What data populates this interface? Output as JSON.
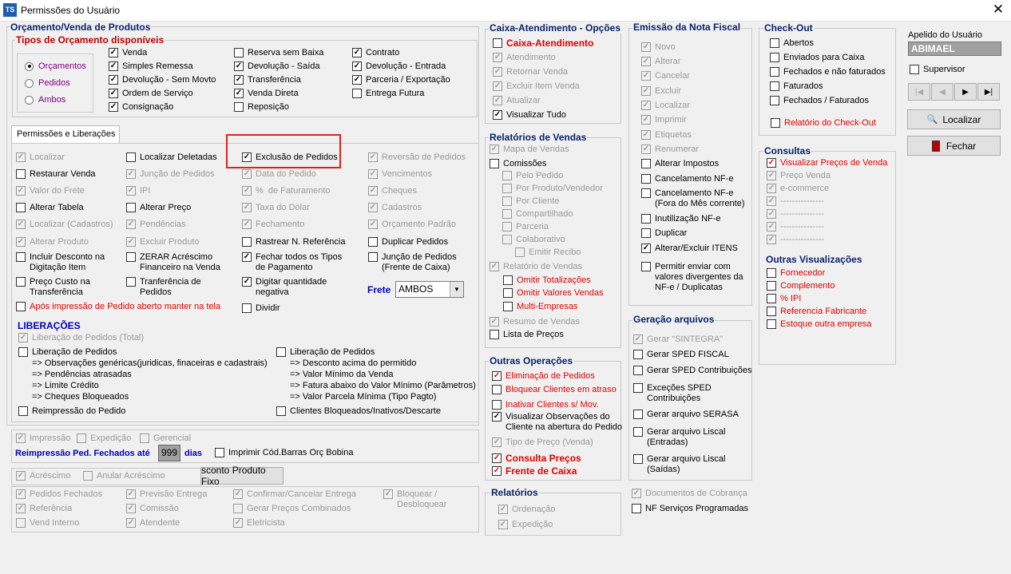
{
  "window": {
    "title": "Permissões do Usuário",
    "icon": "TS",
    "close": "✕"
  },
  "orcamento": {
    "title": "Orçamento/Venda de Produtos",
    "tipos_title": "Tipos de Orçamento disponíveis",
    "radios": [
      {
        "label": "Orçamentos",
        "on": true
      },
      {
        "label": "Pedidos",
        "on": false
      },
      {
        "label": "Ambos",
        "on": false
      }
    ],
    "cols": [
      [
        {
          "l": "Venda",
          "c": true
        },
        {
          "l": "Simples Remessa",
          "c": true
        },
        {
          "l": "Devolução - Sem Movto",
          "c": true
        },
        {
          "l": "Ordem de Serviço",
          "c": true
        },
        {
          "l": "Consignação",
          "c": true
        }
      ],
      [
        {
          "l": "Reserva sem Baixa",
          "c": false
        },
        {
          "l": "Devolução - Saída",
          "c": true
        },
        {
          "l": "Transferência",
          "c": true
        },
        {
          "l": "Venda Direta",
          "c": true
        },
        {
          "l": "Reposição",
          "c": false
        }
      ],
      [
        {
          "l": "Contrato",
          "c": true
        },
        {
          "l": "Devolução - Entrada",
          "c": true
        },
        {
          "l": "Parceria / Exportação",
          "c": true
        },
        {
          "l": "Entrega Futura",
          "c": false
        }
      ]
    ]
  },
  "tab_label": "Permissões e Liberações",
  "perm": [
    [
      {
        "l": "Localizar",
        "c": true,
        "d": true
      },
      {
        "l": "Restaurar Venda",
        "c": false
      },
      {
        "l": "Valor do Frete",
        "c": true,
        "d": true
      },
      {
        "l": "Alterar Tabela",
        "c": false
      },
      {
        "l": "Localizar (Cadastros)",
        "c": true,
        "d": true
      },
      {
        "l": "Alterar Produto",
        "c": true,
        "d": true
      },
      {
        "l": "Incluir Desconto na\nDigitação Item",
        "c": false
      },
      {
        "l": "Preço Custo na\nTransferência",
        "c": false
      }
    ],
    [
      {
        "l": "Localizar Deletadas",
        "c": false
      },
      {
        "l": "Junção de Pedidos",
        "c": true,
        "d": true
      },
      {
        "l": "IPI",
        "c": true,
        "d": true
      },
      {
        "l": "Alterar Preço",
        "c": false
      },
      {
        "l": "Pendências",
        "c": true,
        "d": true
      },
      {
        "l": "Excluir Produto",
        "c": true,
        "d": true
      },
      {
        "l": "ZERAR Acréscimo\nFinanceiro na Venda",
        "c": false
      },
      {
        "l": "Tranferência de\nPedidos",
        "c": false
      }
    ],
    [
      {
        "l": "Exclusão de Pedidos",
        "c": true
      },
      {
        "l": "Data do Pedido",
        "c": true,
        "d": true
      },
      {
        "l": "%  de Faturamento",
        "c": true,
        "d": true
      },
      {
        "l": "Taxa do Dólar",
        "c": true,
        "d": true
      },
      {
        "l": "Fechamento",
        "c": true,
        "d": true
      },
      {
        "l": "Rastrear N. Referência",
        "c": false
      },
      {
        "l": "Fechar todos os Tipos\nde Pagamento",
        "c": true
      },
      {
        "l": "Digitar quantidade\nnegativa",
        "c": true
      },
      {
        "l": "Dividir",
        "c": false
      }
    ],
    [
      {
        "l": "Reversão de Pedidos",
        "c": true,
        "d": true
      },
      {
        "l": "Vencimentos",
        "c": true,
        "d": true
      },
      {
        "l": "Cheques",
        "c": true,
        "d": true
      },
      {
        "l": "Cadastros",
        "c": true,
        "d": true
      },
      {
        "l": "Orçamento Padrão",
        "c": true,
        "d": true
      },
      {
        "l": "Duplicar Pedidos",
        "c": false
      },
      {
        "l": "Junção de Pedidos\n(Frente de Caixa)",
        "c": false
      }
    ]
  ],
  "apos": "Após impressão de Pedido aberto manter na tela",
  "frete": {
    "label": "Frete",
    "value": "AMBOS"
  },
  "liberacoes": {
    "title": "LIBERAÇÕES",
    "total": "Liberação de Pedidos (Total)",
    "lib1": "Liberação de Pedidos",
    "lib1_lines": [
      "=> Observações genéricas(juridicas, finaceiras e cadastrais)",
      "=> Pendências atrasadas",
      "=> Limite Crédito",
      "=> Cheques Bloqueados"
    ],
    "lib2": "Liberação de Pedidos",
    "lib2_lines": [
      "=> Desconto acima do permitido",
      "=> Valor Mínimo da Venda",
      "=> Fatura abaixo do Valor Mínimo (Parâmetros)",
      "=> Valor Parcela Mínima (Tipo Pagto)"
    ],
    "reimp": "Reimpressão do Pedido",
    "clientes": "Clientes Bloqueados/Inativos/Descarte"
  },
  "impressao": {
    "imp": "Impressão",
    "exp": "Expedição",
    "ger": "Gerencial",
    "reimp_label": "Reimpressão Ped. Fechados até",
    "reimp_val": "999",
    "dias": "dias",
    "barras": "Imprimir Cód.Barras Orç Bobina"
  },
  "acrescimo": {
    "acr": "Acréscimo",
    "anular": "Anular Acréscimo",
    "desc": "sconto Produto Fixo"
  },
  "bottom": [
    [
      {
        "l": "Pedidos Fechados",
        "c": true,
        "d": true
      },
      {
        "l": "Referência",
        "c": true,
        "d": true
      },
      {
        "l": "Vend Interno",
        "c": false,
        "d": true
      }
    ],
    [
      {
        "l": "Previsão Entrega",
        "c": true,
        "d": true
      },
      {
        "l": "Comissão",
        "c": true,
        "d": true
      },
      {
        "l": "Atendente",
        "c": true,
        "d": true
      }
    ],
    [
      {
        "l": "Confirmar/Cancelar Entrega",
        "c": true,
        "d": true
      },
      {
        "l": "Gerar Preços Combinados",
        "c": false,
        "d": true
      },
      {
        "l": "Eletricista",
        "c": true,
        "d": true
      }
    ],
    [
      {
        "l": "Bloquear /\nDesbloquear",
        "c": true,
        "d": true
      }
    ]
  ],
  "caixa": {
    "title": "Caixa-Atendimento - Opções",
    "items": [
      {
        "l": "Caixa-Atendimento",
        "c": false,
        "r": true,
        "b": true
      },
      {
        "l": "Atendimento",
        "c": true,
        "d": true
      },
      {
        "l": "Retornar Venda",
        "c": true,
        "d": true
      },
      {
        "l": "Excluir Item Venda",
        "c": true,
        "d": true
      },
      {
        "l": "Atualizar",
        "c": true,
        "d": true
      },
      {
        "l": "Visualizar Tudo",
        "c": true
      }
    ]
  },
  "relvendas": {
    "title": "Relatórios de Vendas",
    "mapa": "Mapa de Vendas",
    "comissoes": "Comissões",
    "sub": [
      "Pelo Pedido",
      "Por Produto/Vendedor",
      "Por Cliente",
      "Compartilhado",
      "Parceria",
      "Colaborativo"
    ],
    "emitir": "Emitir Recibo",
    "relatorio": "Relatório de Vendas",
    "omitir1": "Omitir Totalizações",
    "omitir2": "Omitir Valores Vendas",
    "multi": "Multi-Empresas",
    "resumo": "Resumo de Vendas",
    "lista": "Lista de Preços"
  },
  "outras": {
    "title": "Outras Operações",
    "items": [
      {
        "l": "Eliminação de Pedidos",
        "c": true,
        "r": true
      },
      {
        "l": "Bloquear Clientes em atraso",
        "c": false,
        "r": true
      },
      {
        "l": "Inativar Clientes s/ Mov.",
        "c": false,
        "r": true
      },
      {
        "l": "Visualizar Observações do\nCliente na abertura do Pedido",
        "c": true
      },
      {
        "l": "Tipo de Preço (Venda)",
        "c": true,
        "d": true
      },
      {
        "l": "Consulta Preços",
        "c": true,
        "r": true,
        "b": true
      },
      {
        "l": "Frente de Caixa",
        "c": true,
        "r": true,
        "b": true
      }
    ]
  },
  "relatorios": {
    "title": "Relatórios",
    "items": [
      "Ordenação",
      "Expedição"
    ]
  },
  "nf": {
    "title": "Emissão da Nota Fiscal",
    "items": [
      {
        "l": "Novo",
        "c": true,
        "d": true
      },
      {
        "l": "Alterar",
        "c": true,
        "d": true
      },
      {
        "l": "Cancelar",
        "c": true,
        "d": true
      },
      {
        "l": "Excluir",
        "c": true,
        "d": true
      },
      {
        "l": "Localizar",
        "c": true,
        "d": true
      },
      {
        "l": "Imprimir",
        "c": true,
        "d": true
      },
      {
        "l": "Etiquetas",
        "c": true,
        "d": true
      },
      {
        "l": "Renumerar",
        "c": true,
        "d": true
      },
      {
        "l": "Alterar Impostos",
        "c": false
      },
      {
        "l": "Cancelamento NF-e",
        "c": false
      },
      {
        "l": "Cancelamento NF-e\n(Fora do Mês corrente)",
        "c": false
      },
      {
        "l": "Inutilização NF-e",
        "c": false
      },
      {
        "l": "Duplicar",
        "c": false
      },
      {
        "l": "Alterar/Excluir ITENS",
        "c": true
      },
      {
        "l": "Permitir enviar com\nvalores divergentes da\nNF-e / Duplicatas",
        "c": false
      }
    ]
  },
  "geracao": {
    "title": "Geração arquivos",
    "items": [
      {
        "l": "Gerar \"SINTEGRA\"",
        "c": true,
        "d": true
      },
      {
        "l": "Gerar SPED FISCAL",
        "c": false
      },
      {
        "l": "Gerar SPED Contribuições",
        "c": false
      },
      {
        "l": "Exceções SPED\nContribuições",
        "c": false
      },
      {
        "l": "Gerar arquivo SERASA",
        "c": false
      },
      {
        "l": "Gerar arquivo Liscal\n(Entradas)",
        "c": false
      },
      {
        "l": "Gerar arquivo Liscal\n(Saídas)",
        "c": false
      }
    ],
    "doc": "Documentos de Cobrança",
    "nfserv": "NF Serviços Programadas"
  },
  "checkout": {
    "title": "Check-Out",
    "items": [
      "Abertos",
      "Enviados para Caixa",
      "Fechados e não faturados",
      "Faturados",
      "Fechados / Faturados"
    ],
    "rel": "Relatório do Check-Out"
  },
  "consultas": {
    "title": "Consultas",
    "items": [
      {
        "l": "Visualizar Preços de Venda",
        "c": true,
        "r": true
      },
      {
        "l": "Preço Venda",
        "c": true,
        "d": true
      },
      {
        "l": "e-commerce",
        "c": true,
        "d": true
      },
      {
        "l": "---------------",
        "c": true,
        "d": true
      },
      {
        "l": "---------------",
        "c": true,
        "d": true
      },
      {
        "l": "---------------",
        "c": true,
        "d": true
      },
      {
        "l": "---------------",
        "c": true,
        "d": true
      }
    ]
  },
  "outrasvis": {
    "title": "Outras Visualizações",
    "items": [
      "Fornecedor",
      "Complemento",
      "% IPI",
      "Referencia Fabricante",
      "Estoque outra empresa"
    ]
  },
  "user": {
    "label": "Apelido do Usuário",
    "value": "ABIMAEL",
    "supervisor": "Supervisor",
    "nav": [
      "|◀",
      "◀",
      "▶",
      "▶|"
    ],
    "localizar": "Localizar",
    "fechar": "Fechar"
  }
}
